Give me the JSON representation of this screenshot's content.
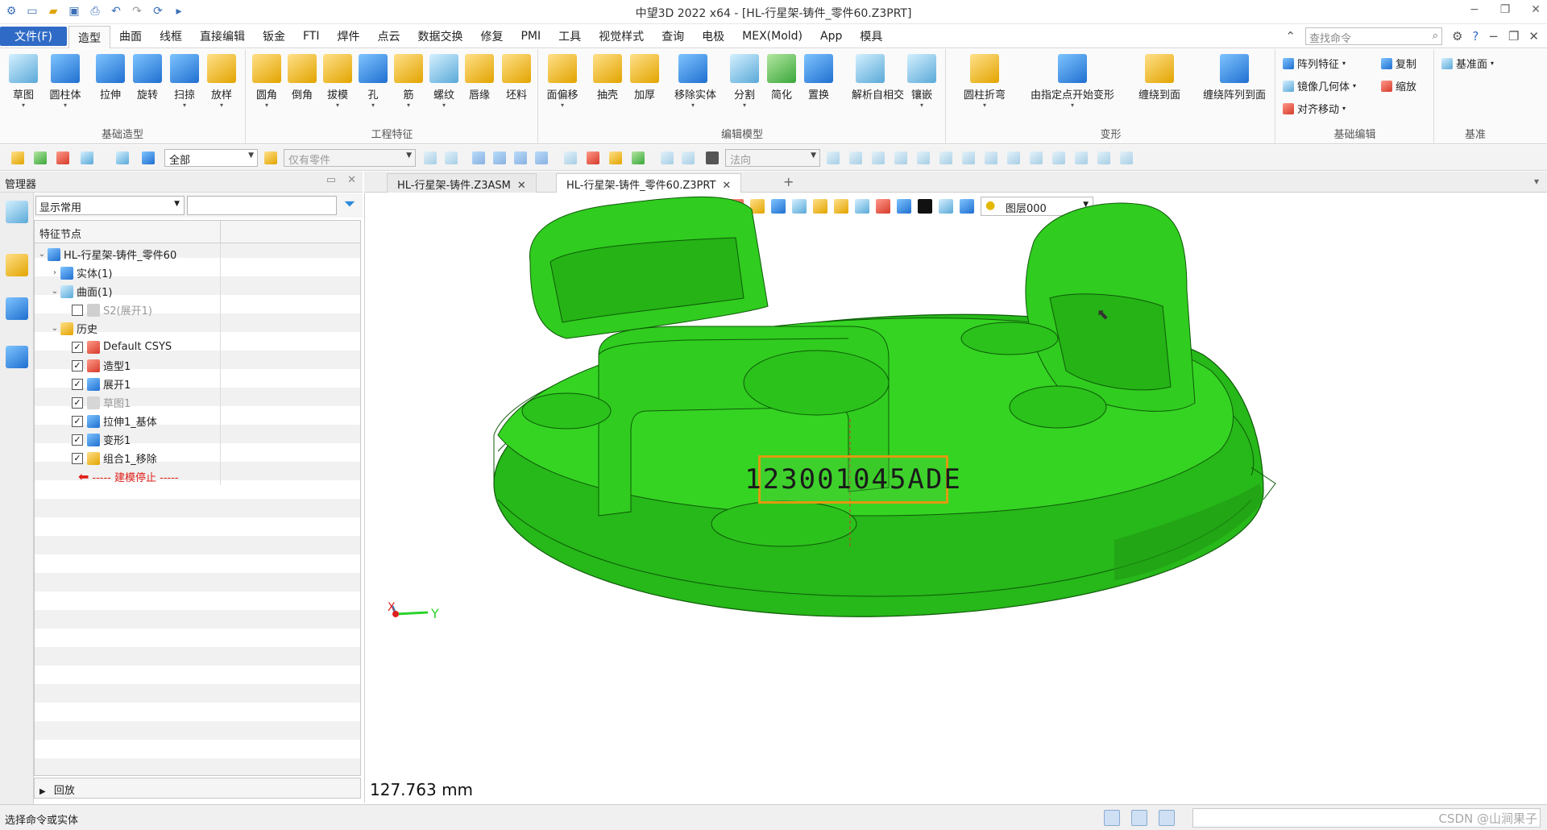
{
  "titlebar": {
    "title": "中望3D 2022 x64 - [HL-行星架-铸件_零件60.Z3PRT]",
    "window_controls": [
      "−",
      "❐",
      "✕"
    ]
  },
  "menubar": {
    "file": "文件(F)",
    "tabs": [
      "造型",
      "曲面",
      "线框",
      "直接编辑",
      "钣金",
      "FTI",
      "焊件",
      "点云",
      "数据交换",
      "修复",
      "PMI",
      "工具",
      "视觉样式",
      "查询",
      "电极",
      "MEX(Mold)",
      "App",
      "模具"
    ],
    "active_tab": "造型",
    "search_placeholder": "查找命令"
  },
  "ribbon": {
    "groups": [
      {
        "label": "基础造型",
        "buttons": [
          "草图",
          "圆柱体",
          "拉伸",
          "旋转",
          "扫掠",
          "放样"
        ]
      },
      {
        "label": "工程特征",
        "buttons": [
          "圆角",
          "倒角",
          "拔模",
          "孔",
          "筋",
          "螺纹",
          "唇缘",
          "坯料"
        ]
      },
      {
        "label": "编辑模型",
        "buttons": [
          "面偏移",
          "抽壳",
          "加厚",
          "移除实体",
          "分割",
          "简化",
          "置换",
          "解析自相交",
          "镶嵌"
        ]
      },
      {
        "label": "变形",
        "buttons": [
          "圆柱折弯",
          "由指定点开始变形",
          "缠绕到面",
          "缠绕阵列到面"
        ]
      },
      {
        "label": "基础编辑",
        "small": [
          "阵列特征",
          "镜像几何体",
          "对齐移动",
          "复制",
          "缩放"
        ]
      },
      {
        "label": "基准",
        "small": [
          "基准面"
        ]
      }
    ]
  },
  "toolbar2": {
    "filter_value": "全部",
    "part_filter": "仅有零件",
    "direction": "法向"
  },
  "manager": {
    "title": "管理器",
    "display_filter": "显示常用",
    "column_header": "特征节点",
    "tree": {
      "root": "HL-行星架-铸件_零件60",
      "solid": "实体(1)",
      "surface": "曲面(1)",
      "surface_child": "S2(展开1)",
      "history": "历史",
      "history_items": [
        "Default CSYS",
        "造型1",
        "展开1",
        "草图1",
        "拉伸1_基体",
        "变形1",
        "组合1_移除"
      ],
      "stop": "----- 建模停止 -----"
    },
    "replay": "回放"
  },
  "doctabs": {
    "tabs": [
      "HL-行星架-铸件.Z3ASM",
      "HL-行星架-铸件_零件60.Z3PRT"
    ],
    "active": 1
  },
  "viewport": {
    "layer": "图层000",
    "part_label": "123001045ADE",
    "distance": "127.763 mm",
    "axis_x": "X",
    "axis_y": "Y",
    "model_color": "#2ecc1e",
    "label_border_color": "#e09a10"
  },
  "statusbar": {
    "message": "选择命令或实体",
    "watermark": "CSDN @山涧果子"
  }
}
